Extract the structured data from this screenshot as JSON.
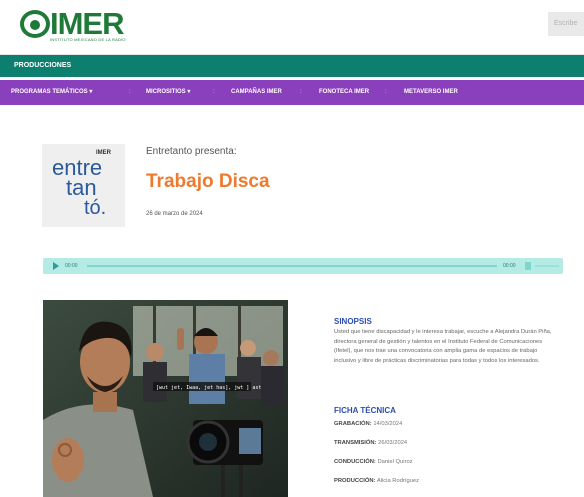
{
  "header": {
    "logo_text": "IMER",
    "logo_subtitle": "INSTITUTO MEXICANO DE LA RADIO",
    "write_label": "Escribe"
  },
  "greenbar": {
    "label": "PRODUCCIONES"
  },
  "nav": {
    "items": [
      {
        "label": "PROGRAMAS TEMÁTICOS",
        "dropdown": true
      },
      {
        "label": "MICROSITIOS",
        "dropdown": true
      },
      {
        "label": "CAMPAÑAS IMER",
        "dropdown": false
      },
      {
        "label": "FONOTECA IMER",
        "dropdown": false
      },
      {
        "label": "METAVERSO IMER",
        "dropdown": false
      }
    ],
    "separator": ":",
    "dropdown_glyph": "▾"
  },
  "episode": {
    "thumb_brand": "IMER",
    "thumb_word_1": "entre",
    "thumb_word_2": "tan",
    "thumb_word_3": "tó.",
    "presents": "Entretanto presenta:",
    "title": "Trabajo Disca",
    "date": "26 de marzo de 2024"
  },
  "audio": {
    "current_time": "00:00",
    "duration": "00:00",
    "progress": 0
  },
  "photo": {
    "caption_overlay": "[wut jet, Iwaa, jet has], jwt ] ast"
  },
  "sinopsis": {
    "heading": "SINOPSIS",
    "text": "Usted que tiene discapacidad y le interesa trabajar, escuche a Alejandra Durán Piña, directora general de gestión y talentos en el Instituto Federal de Comunicaciones (Ifetel), que nos trae una convocatoria con amplia gama de espacios de trabajo inclusivo y libre de prácticas discriminatorias para todas y todos los interesados."
  },
  "ficha": {
    "heading": "FICHA TÉCNICA",
    "rows": [
      {
        "label": "GRABACIÓN:",
        "value": "14/03/2024"
      },
      {
        "label": "TRANSMISIÓN:",
        "value": "26/03/2024"
      },
      {
        "label": "CONDUCCIÓN:",
        "value": "Daniel Quiroz"
      },
      {
        "label": "PRODUCCIÓN:",
        "value": "Alicia Rodríguez"
      }
    ]
  },
  "colors": {
    "brand_green": "#1f7a3a",
    "greenbar": "#0c7f6f",
    "purplebar": "#8a3fbc",
    "title_orange": "#ee7a2f",
    "heading_blue": "#2a4fb0",
    "audio_bg": "#b4ebe4"
  }
}
